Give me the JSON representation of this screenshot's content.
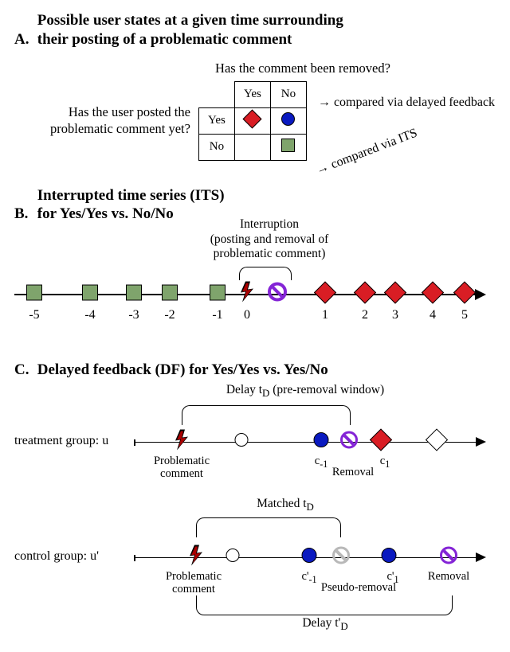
{
  "panelA": {
    "letter": "A.",
    "title_l1": "Possible user states at a given time surrounding",
    "title_l2": "their posting of a problematic comment",
    "col_question": "Has the comment been removed?",
    "row_question_l1": "Has the user posted the",
    "row_question_l2": "problematic comment yet?",
    "col_yes": "Yes",
    "col_no": "No",
    "row_yes": "Yes",
    "row_no": "No",
    "cmp_delayed": "→ compared via delayed feedback",
    "cmp_its": "→ compared via ITS"
  },
  "panelB": {
    "letter": "B.",
    "title_l1": "Interrupted time series (ITS)",
    "title_l2": "for Yes/Yes vs. No/No",
    "interruption_l1": "Interruption",
    "interruption_l2": "(posting and removal of",
    "interruption_l3": "problematic comment)",
    "ticks": [
      "-5",
      "-4",
      "-3",
      "-2",
      "-1",
      "0",
      "1",
      "2",
      "3",
      "4",
      "5"
    ]
  },
  "panelC": {
    "letter": "C.",
    "title": "Delayed feedback (DF) for Yes/Yes vs. Yes/No",
    "delay_td": "Delay t",
    "delay_td_sub": "D",
    "delay_td_paren": " (pre-removal window)",
    "treatment_label": "treatment group: u",
    "control_label": "control group: u'",
    "problematic_l1": "Problematic",
    "problematic_l2": "comment",
    "removal": "Removal",
    "pseudo_removal": "Pseudo-removal",
    "c_m1": "c",
    "c_m1_sub": "-1",
    "c_1": "c",
    "c_1_sub": "1",
    "cp_m1": "c'",
    "cp_m1_sub": "-1",
    "cp_1": "c'",
    "cp_1_sub": "1",
    "matched": "Matched  t",
    "matched_sub": "D",
    "delay_tpD": "Delay t'",
    "delay_tpD_sub": "D"
  }
}
